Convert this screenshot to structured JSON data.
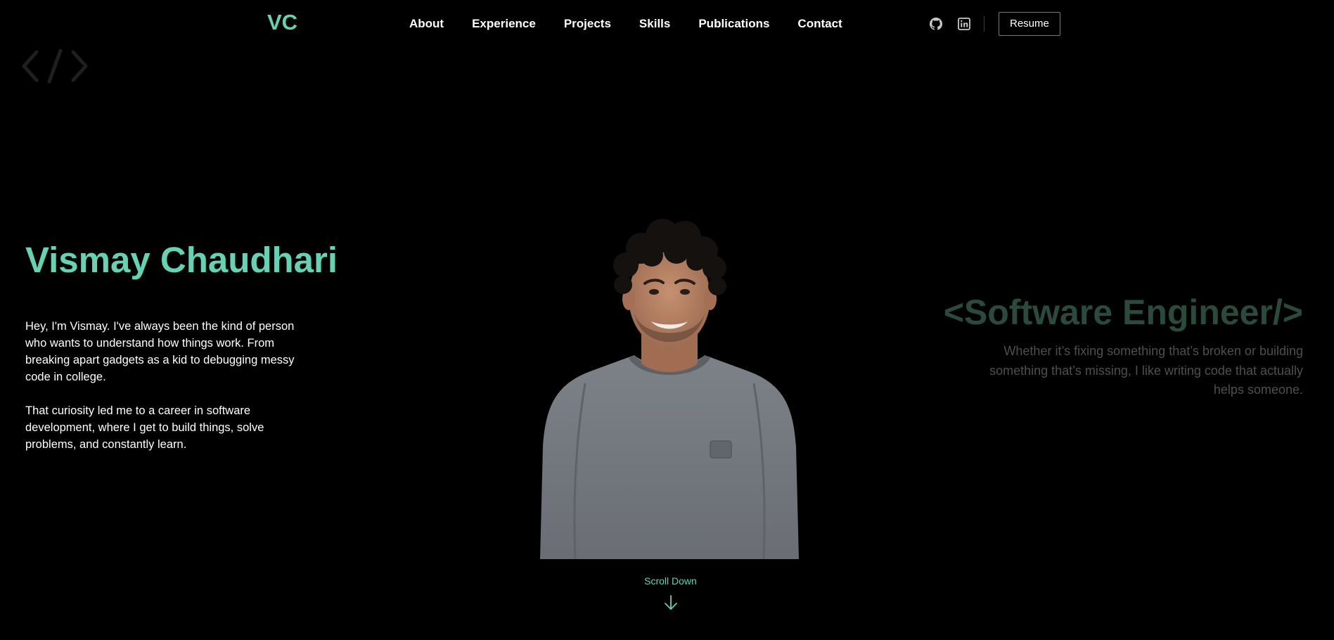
{
  "nav": {
    "logo": "VC",
    "links": [
      {
        "label": "About"
      },
      {
        "label": "Experience"
      },
      {
        "label": "Projects"
      },
      {
        "label": "Skills"
      },
      {
        "label": "Publications"
      },
      {
        "label": "Contact"
      }
    ],
    "icons": [
      "github-icon",
      "linkedin-icon"
    ],
    "resume_label": "Resume"
  },
  "hero": {
    "name": "Vismay Chaudhari",
    "intro_paragraphs": [
      "Hey, I'm Vismay. I've always been the kind of person who wants to understand how things work. From breaking apart gadgets as a kid to debugging messy code in college.",
      "That curiosity led me to a career in software development, where I get to build things, solve problems, and constantly learn."
    ]
  },
  "role": {
    "title": "<Software Engineer/>",
    "description": "Whether it’s fixing something that’s broken or building something that’s missing, I like writing code that actually helps someone."
  },
  "scroll": {
    "label": "Scroll Down"
  },
  "colors": {
    "accent": "#64d2b3",
    "background": "#000000",
    "role_title": "#2a4a3e",
    "muted_text": "#4f4f4f"
  }
}
